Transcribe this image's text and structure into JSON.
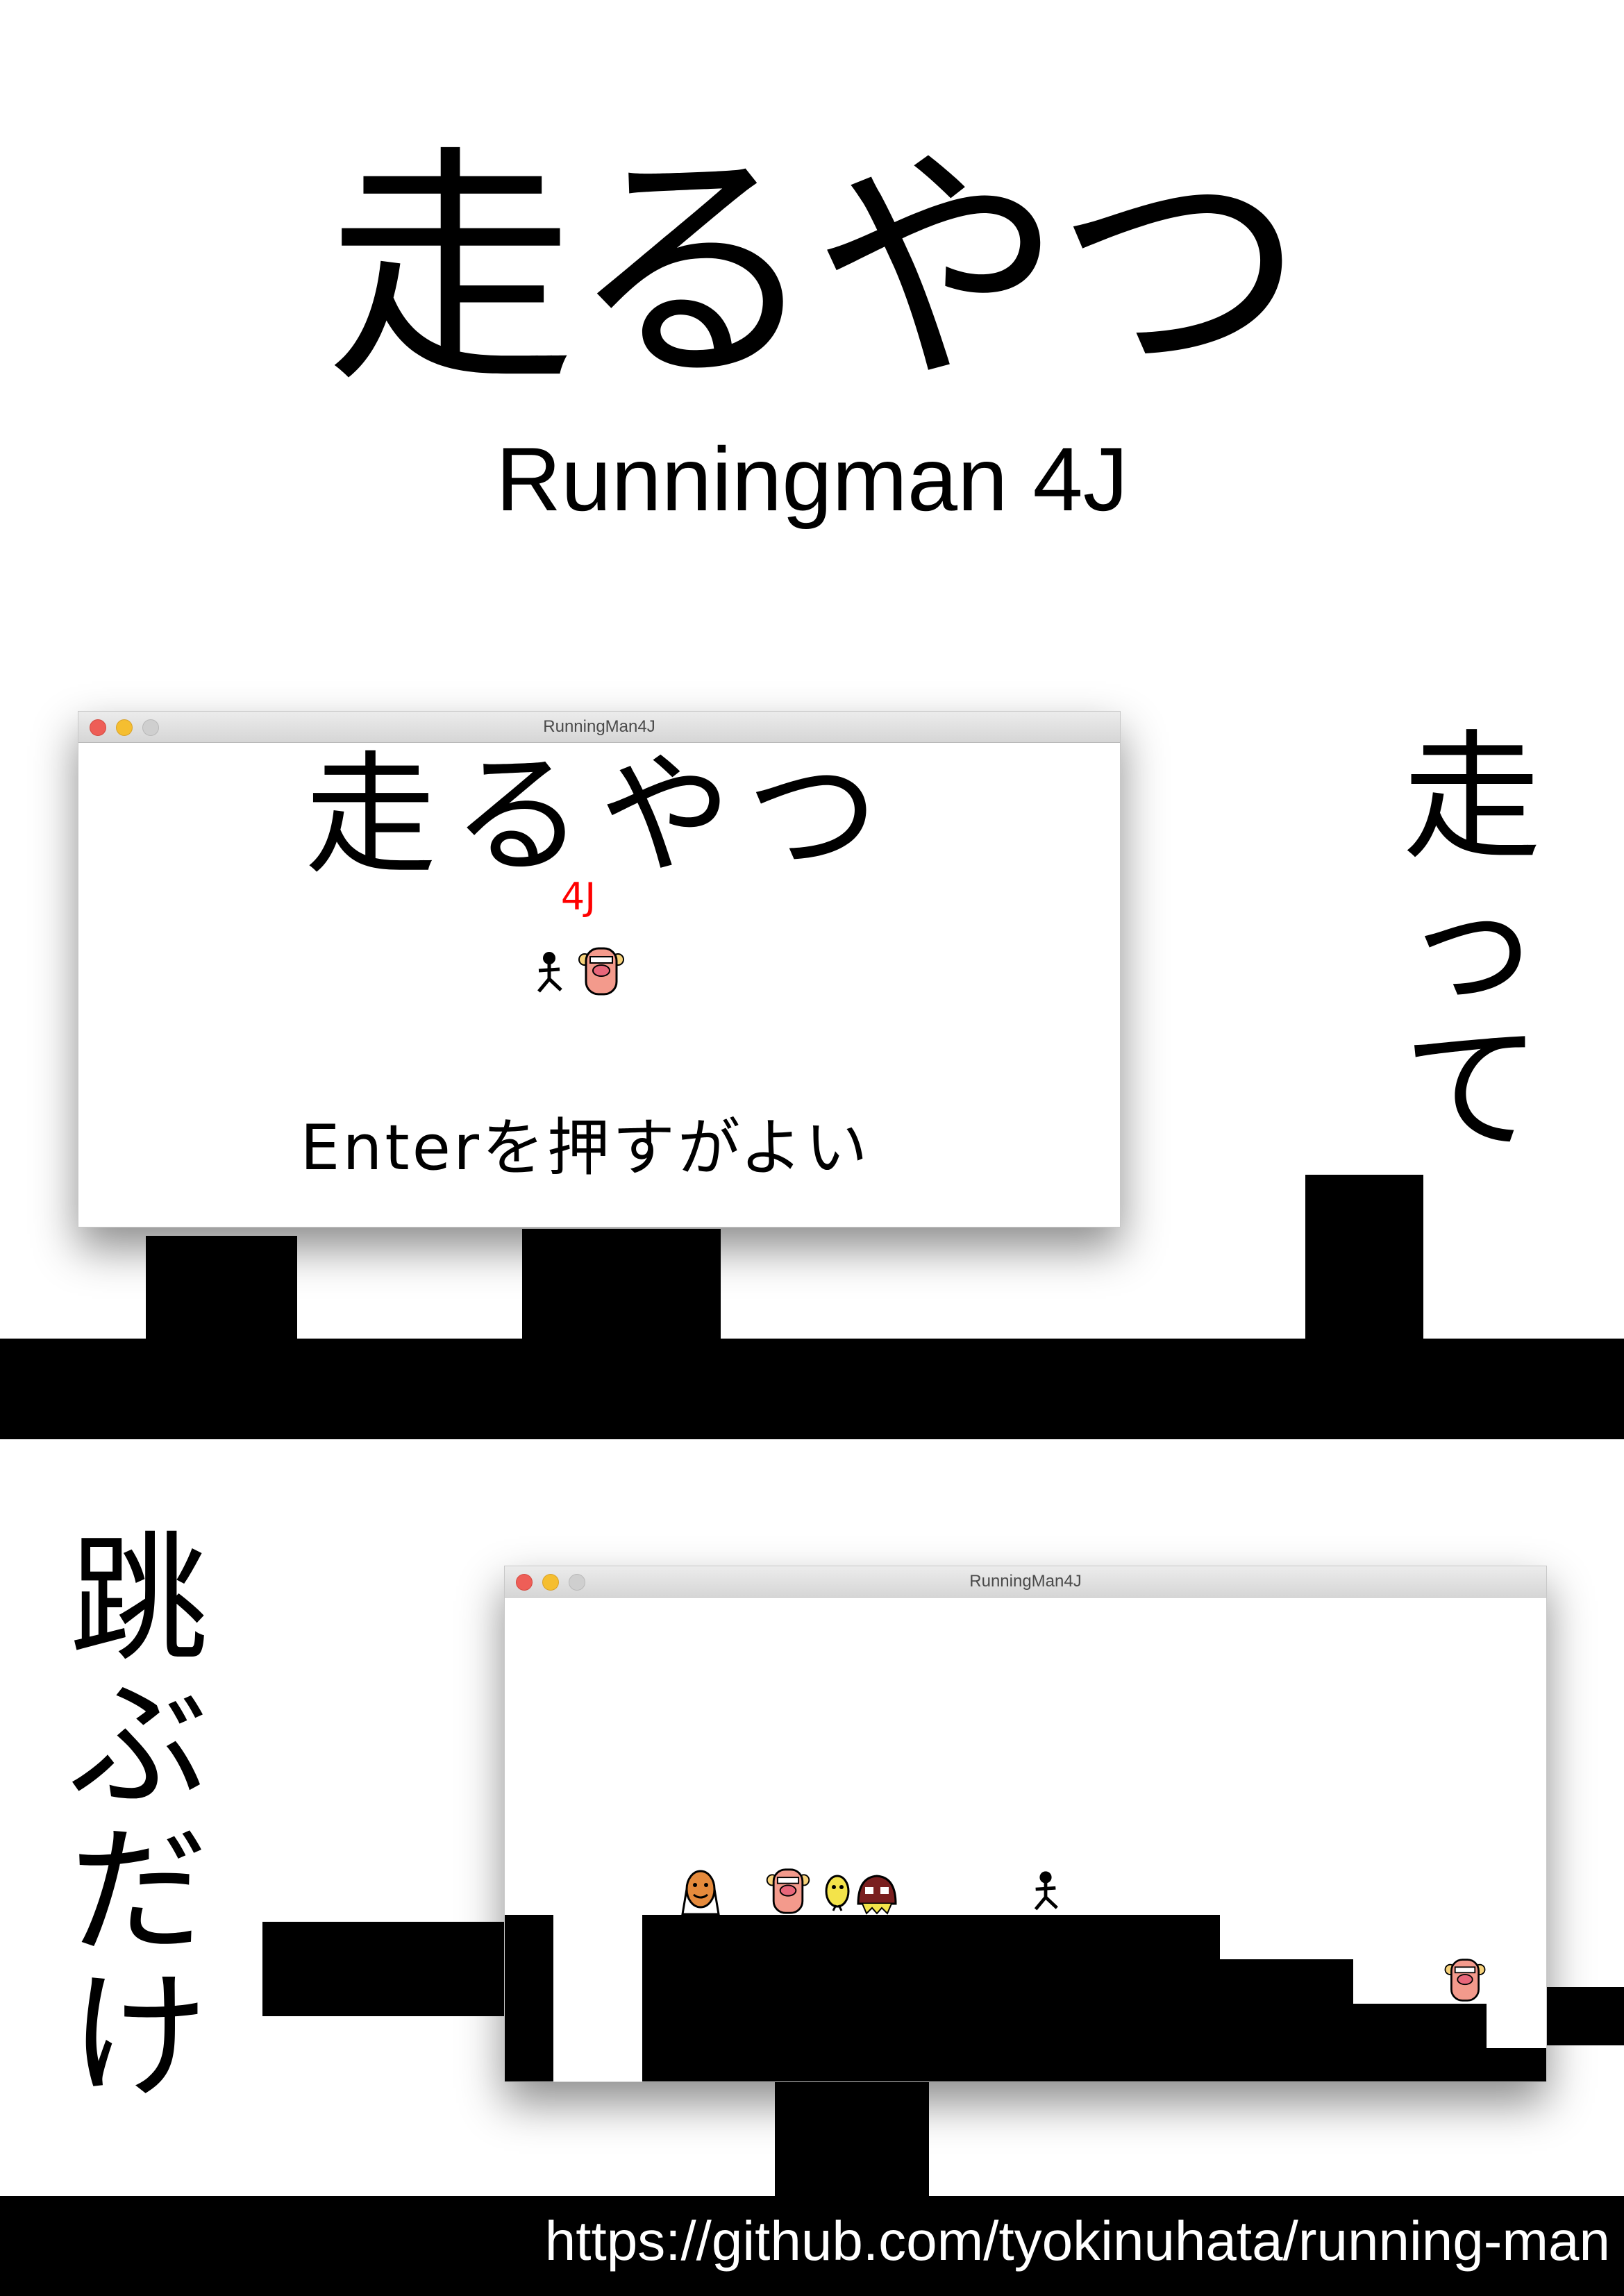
{
  "poster": {
    "title": "走るやつ",
    "subtitle": "Runningman 4J",
    "vertical_right": [
      "走",
      "っ",
      "て"
    ],
    "vertical_left": [
      "跳",
      "ぶ",
      "だ",
      "け"
    ],
    "url": "https://github.com/tyokinuhata/running-man"
  },
  "window1": {
    "title": "RunningMan4J",
    "game_title": "走るやつ",
    "version": "4J",
    "prompt": "Enterを押すがよい"
  },
  "window2": {
    "title": "RunningMan4J"
  },
  "colors": {
    "background": "#ffffff",
    "platform": "#000000",
    "version_text": "#ff0000",
    "close_button": "#ee5e57",
    "minimize_button": "#f5be30",
    "zoom_button": "#cfcfcf"
  },
  "icons": {
    "player": "stick-figure-runner-icon",
    "enemies": [
      "pink-monkey-enemy-icon",
      "orange-creature-enemy-icon",
      "yellow-bird-enemy-icon",
      "brown-blob-enemy-icon"
    ]
  }
}
